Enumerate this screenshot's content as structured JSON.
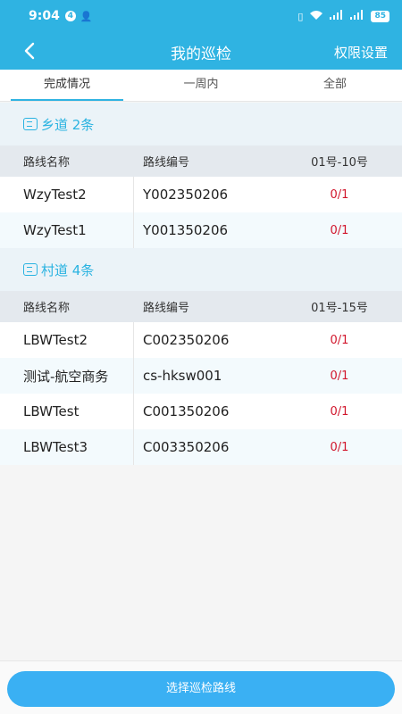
{
  "status_bar": {
    "time": "9:04",
    "notification_count": "4",
    "battery": "85"
  },
  "nav": {
    "title": "我的巡检",
    "right_action": "权限设置"
  },
  "tabs": [
    {
      "label": "完成情况",
      "active": true
    },
    {
      "label": "一周内",
      "active": false
    },
    {
      "label": "全部",
      "active": false
    }
  ],
  "sections": [
    {
      "title": "乡道 2条",
      "columns": [
        "路线名称",
        "路线编号",
        "01号-10号"
      ],
      "rows": [
        {
          "name": "WzyTest2",
          "code": "Y002350206",
          "progress": "0/1"
        },
        {
          "name": "WzyTest1",
          "code": "Y001350206",
          "progress": "0/1"
        }
      ]
    },
    {
      "title": "村道 4条",
      "columns": [
        "路线名称",
        "路线编号",
        "01号-15号"
      ],
      "rows": [
        {
          "name": "LBWTest2",
          "code": "C002350206",
          "progress": "0/1"
        },
        {
          "name": "测试-航空商务",
          "code": "cs-hksw001",
          "progress": "0/1"
        },
        {
          "name": "LBWTest",
          "code": "C001350206",
          "progress": "0/1"
        },
        {
          "name": "LBWTest3",
          "code": "C003350206",
          "progress": "0/1"
        }
      ]
    }
  ],
  "footer": {
    "button_label": "选择巡检路线"
  },
  "colors": {
    "accent": "#2fb3e2",
    "button": "#3ab0f3",
    "progress_text": "#d1162c"
  }
}
